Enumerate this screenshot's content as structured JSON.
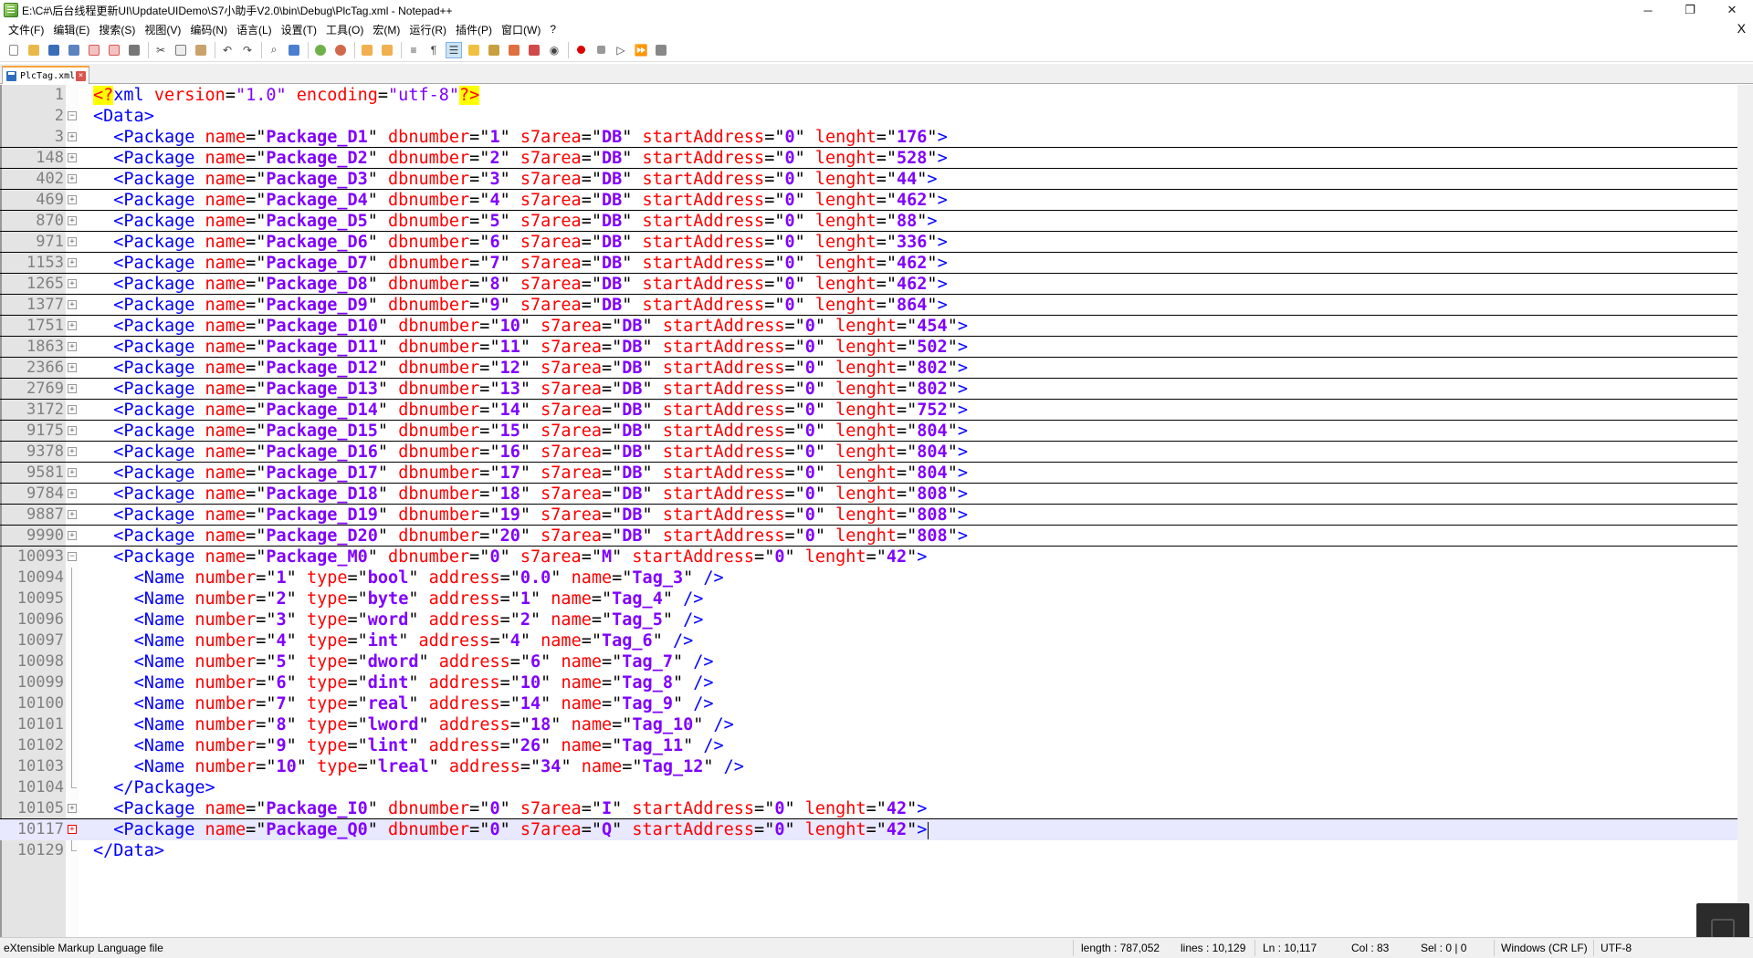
{
  "window": {
    "title": "E:\\C#\\后台线程更新UI\\UpdateUIDemo\\S7小助手V2.0\\bin\\Debug\\PlcTag.xml - Notepad++",
    "controls": [
      "─",
      "❐",
      "✕"
    ]
  },
  "menu": {
    "items": [
      "文件(F)",
      "编辑(E)",
      "搜索(S)",
      "视图(V)",
      "编码(N)",
      "语言(L)",
      "设置(T)",
      "工具(O)",
      "宏(M)",
      "运行(R)",
      "插件(P)",
      "窗口(W)",
      "?"
    ],
    "close": "X"
  },
  "toolbar": {
    "icons": [
      "new-file-icon",
      "open-file-icon",
      "save-icon",
      "save-all-icon",
      "close-icon",
      "close-all-icon",
      "print-icon",
      "cut-icon",
      "copy-icon",
      "paste-icon",
      "undo-icon",
      "redo-icon",
      "find-icon",
      "replace-icon",
      "zoom-in-icon",
      "zoom-out-icon",
      "sync-v-icon",
      "sync-h-icon",
      "word-wrap-icon",
      "all-chars-icon",
      "indent-guide-icon",
      "udl-icon",
      "doc-map-icon",
      "function-list-icon",
      "folder-workspace-icon",
      "monitor-icon",
      "record-macro-icon",
      "stop-record-icon",
      "play-macro-icon",
      "run-macro-multiple-icon",
      "save-macro-icon"
    ]
  },
  "tab": {
    "label": "PlcTag.xml"
  },
  "editor": {
    "lines": [
      {
        "num": "1",
        "kind": "decl"
      },
      {
        "num": "2",
        "kind": "data-open"
      },
      {
        "num": "3",
        "kind": "pkg",
        "name": "Package_D1",
        "db": "1",
        "area": "DB",
        "start": "0",
        "len": "176"
      },
      {
        "num": "148",
        "kind": "pkg",
        "name": "Package_D2",
        "db": "2",
        "area": "DB",
        "start": "0",
        "len": "528"
      },
      {
        "num": "402",
        "kind": "pkg",
        "name": "Package_D3",
        "db": "3",
        "area": "DB",
        "start": "0",
        "len": "44"
      },
      {
        "num": "469",
        "kind": "pkg",
        "name": "Package_D4",
        "db": "4",
        "area": "DB",
        "start": "0",
        "len": "462"
      },
      {
        "num": "870",
        "kind": "pkg",
        "name": "Package_D5",
        "db": "5",
        "area": "DB",
        "start": "0",
        "len": "88"
      },
      {
        "num": "971",
        "kind": "pkg",
        "name": "Package_D6",
        "db": "6",
        "area": "DB",
        "start": "0",
        "len": "336"
      },
      {
        "num": "1153",
        "kind": "pkg",
        "name": "Package_D7",
        "db": "7",
        "area": "DB",
        "start": "0",
        "len": "462"
      },
      {
        "num": "1265",
        "kind": "pkg",
        "name": "Package_D8",
        "db": "8",
        "area": "DB",
        "start": "0",
        "len": "462"
      },
      {
        "num": "1377",
        "kind": "pkg",
        "name": "Package_D9",
        "db": "9",
        "area": "DB",
        "start": "0",
        "len": "864"
      },
      {
        "num": "1751",
        "kind": "pkg",
        "name": "Package_D10",
        "db": "10",
        "area": "DB",
        "start": "0",
        "len": "454"
      },
      {
        "num": "1863",
        "kind": "pkg",
        "name": "Package_D11",
        "db": "11",
        "area": "DB",
        "start": "0",
        "len": "502"
      },
      {
        "num": "2366",
        "kind": "pkg",
        "name": "Package_D12",
        "db": "12",
        "area": "DB",
        "start": "0",
        "len": "802"
      },
      {
        "num": "2769",
        "kind": "pkg",
        "name": "Package_D13",
        "db": "13",
        "area": "DB",
        "start": "0",
        "len": "802"
      },
      {
        "num": "3172",
        "kind": "pkg",
        "name": "Package_D14",
        "db": "14",
        "area": "DB",
        "start": "0",
        "len": "752"
      },
      {
        "num": "9175",
        "kind": "pkg",
        "name": "Package_D15",
        "db": "15",
        "area": "DB",
        "start": "0",
        "len": "804"
      },
      {
        "num": "9378",
        "kind": "pkg",
        "name": "Package_D16",
        "db": "16",
        "area": "DB",
        "start": "0",
        "len": "804"
      },
      {
        "num": "9581",
        "kind": "pkg",
        "name": "Package_D17",
        "db": "17",
        "area": "DB",
        "start": "0",
        "len": "804"
      },
      {
        "num": "9784",
        "kind": "pkg",
        "name": "Package_D18",
        "db": "18",
        "area": "DB",
        "start": "0",
        "len": "808"
      },
      {
        "num": "9887",
        "kind": "pkg",
        "name": "Package_D19",
        "db": "19",
        "area": "DB",
        "start": "0",
        "len": "808"
      },
      {
        "num": "9990",
        "kind": "pkg",
        "name": "Package_D20",
        "db": "20",
        "area": "DB",
        "start": "0",
        "len": "808"
      },
      {
        "num": "10093",
        "kind": "pkg-open",
        "name": "Package_M0",
        "db": "0",
        "area": "M",
        "start": "0",
        "len": "42"
      },
      {
        "num": "10094",
        "kind": "tag",
        "number": "1",
        "type": "bool",
        "address": "0.0",
        "tname": "Tag_3"
      },
      {
        "num": "10095",
        "kind": "tag",
        "number": "2",
        "type": "byte",
        "address": "1",
        "tname": "Tag_4"
      },
      {
        "num": "10096",
        "kind": "tag",
        "number": "3",
        "type": "word",
        "address": "2",
        "tname": "Tag_5"
      },
      {
        "num": "10097",
        "kind": "tag",
        "number": "4",
        "type": "int",
        "address": "4",
        "tname": "Tag_6"
      },
      {
        "num": "10098",
        "kind": "tag",
        "number": "5",
        "type": "dword",
        "address": "6",
        "tname": "Tag_7"
      },
      {
        "num": "10099",
        "kind": "tag",
        "number": "6",
        "type": "dint",
        "address": "10",
        "tname": "Tag_8"
      },
      {
        "num": "10100",
        "kind": "tag",
        "number": "7",
        "type": "real",
        "address": "14",
        "tname": "Tag_9"
      },
      {
        "num": "10101",
        "kind": "tag",
        "number": "8",
        "type": "lword",
        "address": "18",
        "tname": "Tag_10"
      },
      {
        "num": "10102",
        "kind": "tag",
        "number": "9",
        "type": "lint",
        "address": "26",
        "tname": "Tag_11"
      },
      {
        "num": "10103",
        "kind": "tag",
        "number": "10",
        "type": "lreal",
        "address": "34",
        "tname": "Tag_12"
      },
      {
        "num": "10104",
        "kind": "pkg-close"
      },
      {
        "num": "10105",
        "kind": "pkg",
        "name": "Package_I0",
        "db": "0",
        "area": "I",
        "start": "0",
        "len": "42"
      },
      {
        "num": "10117",
        "kind": "pkg",
        "name": "Package_Q0",
        "db": "0",
        "area": "Q",
        "start": "0",
        "len": "42",
        "current": true
      },
      {
        "num": "10129",
        "kind": "data-close"
      }
    ]
  },
  "status": {
    "filetype": "eXtensible Markup Language file",
    "length": "length : 787,052",
    "lines": "lines : 10,129",
    "ln": "Ln : 10,117",
    "col": "Col : 83",
    "sel": "Sel : 0 | 0",
    "eol": "Windows (CR LF)",
    "encoding": "UTF-8"
  }
}
